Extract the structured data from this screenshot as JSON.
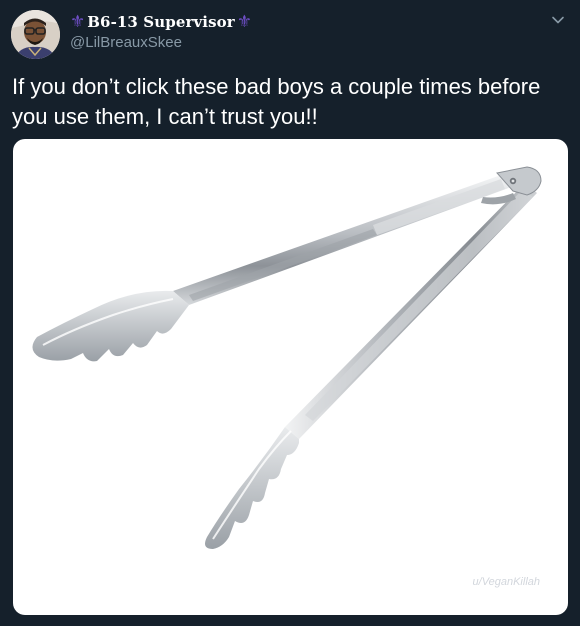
{
  "user": {
    "display_name": "B6-13 Supervisor",
    "handle": "@LilBreauxSkee",
    "name_icon": "fleur-de-lis",
    "name_icon_color": "#6f4fc7"
  },
  "tweet": {
    "text": "If you don’t click these bad boys a couple times before you use them, I can’t trust you!!"
  },
  "media": {
    "subject": "stainless steel kitchen tongs",
    "watermark": "u/VeganKillah"
  },
  "menu": {
    "icon": "chevron-down-icon"
  },
  "colors": {
    "background": "#15202b",
    "primary_text": "#ffffff",
    "secondary_text": "#8899a6"
  }
}
